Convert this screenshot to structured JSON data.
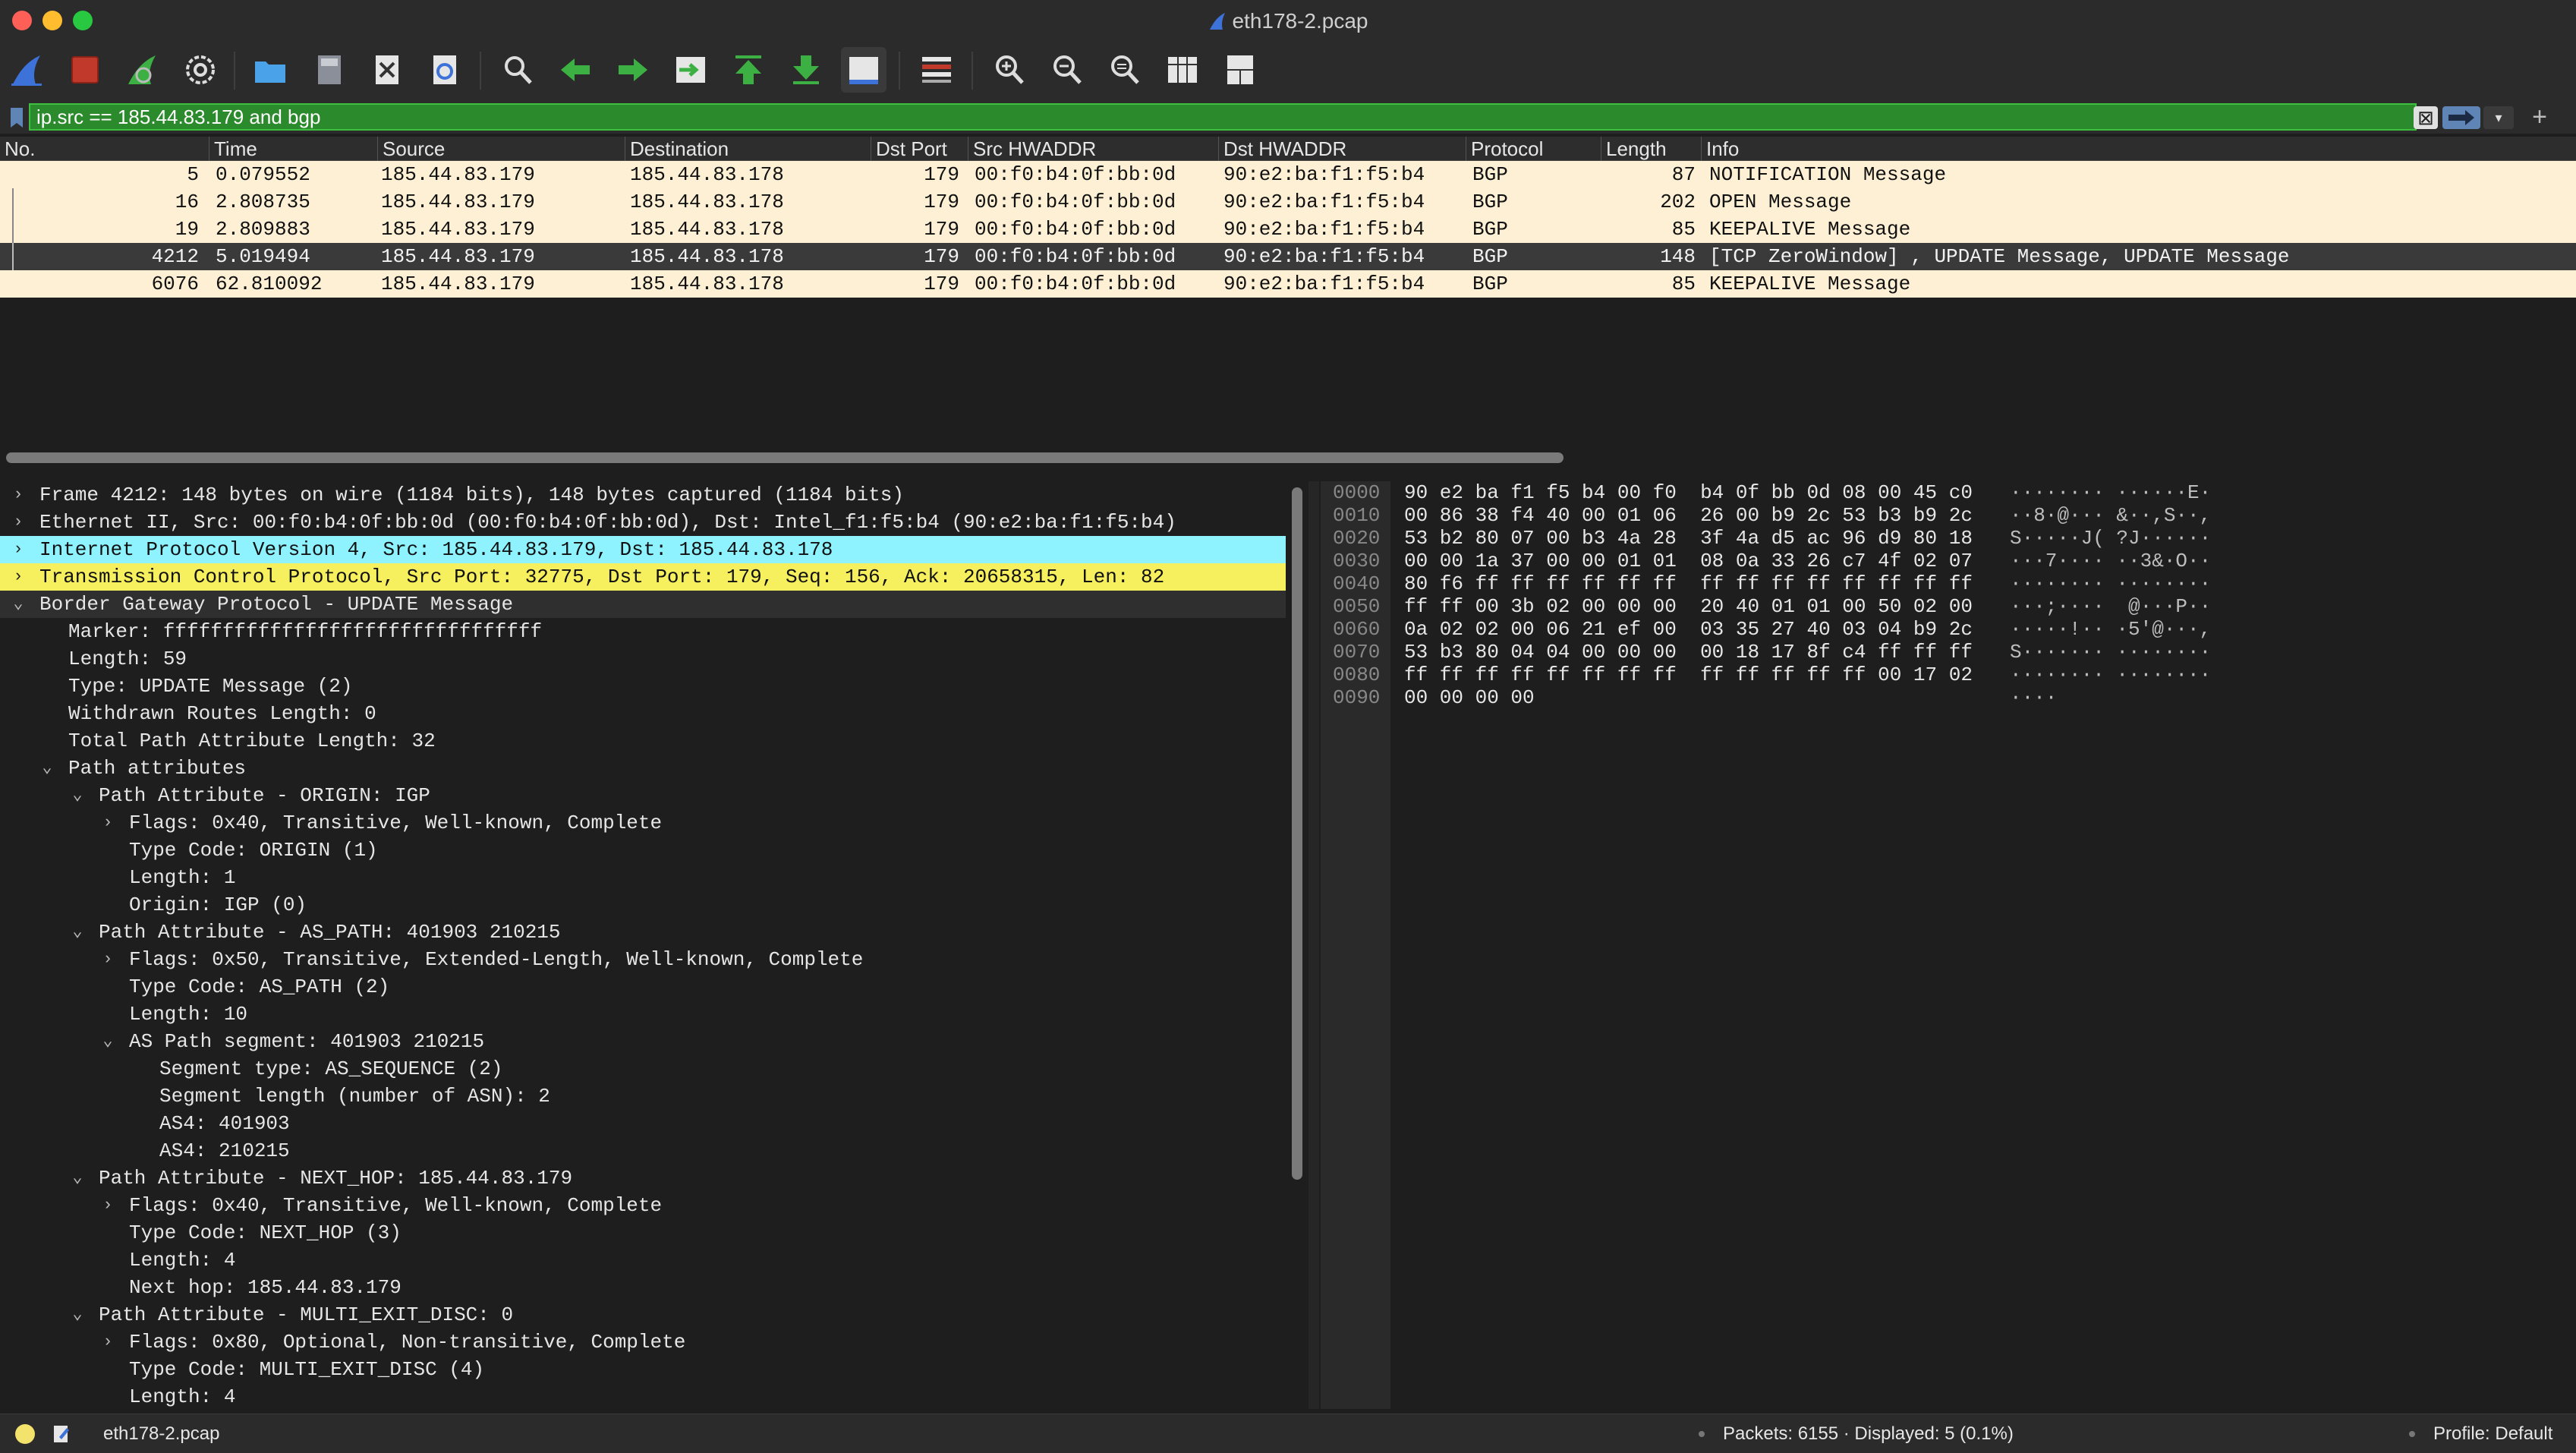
{
  "window": {
    "title": "eth178-2.pcap"
  },
  "toolbar": {
    "icons": [
      "shark-start-icon",
      "stop-icon",
      "restart-icon",
      "options-gear-icon",
      "open-folder-icon",
      "save-file-icon",
      "close-file-icon",
      "reload-icon",
      "find-icon",
      "back-arrow-icon",
      "forward-arrow-icon",
      "goto-packet-icon",
      "first-packet-icon",
      "last-packet-icon",
      "autoscroll-icon",
      "colorize-icon",
      "zoom-in-icon",
      "zoom-out-icon",
      "zoom-normal-icon",
      "resize-columns-icon",
      "layout-icon"
    ],
    "colors": {
      "blue": "#3d72d8",
      "green": "#3cb043",
      "red": "#c0392b"
    }
  },
  "filter": {
    "value": "ip.src == 185.44.83.179 and bgp",
    "clear_label": "⊠",
    "dropdown_label": "▾",
    "add_label": "+"
  },
  "packet_list": {
    "columns": [
      "No.",
      "Time",
      "Source",
      "Destination",
      "Dst Port",
      "Src HWADDR",
      "Dst HWADDR",
      "Protocol",
      "Length",
      "Info"
    ],
    "rows": [
      {
        "no": "5",
        "time": "0.079552",
        "src": "185.44.83.179",
        "dst": "185.44.83.178",
        "dport": "179",
        "srchw": "00:f0:b4:0f:bb:0d",
        "dsthw": "90:e2:ba:f1:f5:b4",
        "proto": "BGP",
        "len": "87",
        "info": "NOTIFICATION Message"
      },
      {
        "no": "16",
        "time": "2.808735",
        "src": "185.44.83.179",
        "dst": "185.44.83.178",
        "dport": "179",
        "srchw": "00:f0:b4:0f:bb:0d",
        "dsthw": "90:e2:ba:f1:f5:b4",
        "proto": "BGP",
        "len": "202",
        "info": "OPEN Message"
      },
      {
        "no": "19",
        "time": "2.809883",
        "src": "185.44.83.179",
        "dst": "185.44.83.178",
        "dport": "179",
        "srchw": "00:f0:b4:0f:bb:0d",
        "dsthw": "90:e2:ba:f1:f5:b4",
        "proto": "BGP",
        "len": "85",
        "info": "KEEPALIVE Message"
      },
      {
        "no": "4212",
        "time": "5.019494",
        "src": "185.44.83.179",
        "dst": "185.44.83.178",
        "dport": "179",
        "srchw": "00:f0:b4:0f:bb:0d",
        "dsthw": "90:e2:ba:f1:f5:b4",
        "proto": "BGP",
        "len": "148",
        "info": "[TCP ZeroWindow] , UPDATE Message, UPDATE Message"
      },
      {
        "no": "6076",
        "time": "62.810092",
        "src": "185.44.83.179",
        "dst": "185.44.83.178",
        "dport": "179",
        "srchw": "00:f0:b4:0f:bb:0d",
        "dsthw": "90:e2:ba:f1:f5:b4",
        "proto": "BGP",
        "len": "85",
        "info": "KEEPALIVE Message"
      }
    ]
  },
  "details": {
    "rows": [
      {
        "text": "Frame 4212: 148 bytes on wire (1184 bits), 148 bytes captured (1184 bits)",
        "arrow": "›"
      },
      {
        "text": "Ethernet II, Src: 00:f0:b4:0f:bb:0d (00:f0:b4:0f:bb:0d), Dst: Intel_f1:f5:b4 (90:e2:ba:f1:f5:b4)",
        "arrow": "›"
      },
      {
        "text": "Internet Protocol Version 4, Src: 185.44.83.179, Dst: 185.44.83.178",
        "arrow": "›"
      },
      {
        "text": "Transmission Control Protocol, Src Port: 32775, Dst Port: 179, Seq: 156, Ack: 20658315, Len: 82",
        "arrow": "›"
      },
      {
        "text": "Border Gateway Protocol - UPDATE Message",
        "arrow": "⌄"
      },
      {
        "text": "Marker: ffffffffffffffffffffffffffffffff",
        "arrow": ""
      },
      {
        "text": "Length: 59",
        "arrow": ""
      },
      {
        "text": "Type: UPDATE Message (2)",
        "arrow": ""
      },
      {
        "text": "Withdrawn Routes Length: 0",
        "arrow": ""
      },
      {
        "text": "Total Path Attribute Length: 32",
        "arrow": ""
      },
      {
        "text": "Path attributes",
        "arrow": "⌄"
      },
      {
        "text": "Path Attribute - ORIGIN: IGP",
        "arrow": "⌄"
      },
      {
        "text": "Flags: 0x40, Transitive, Well-known, Complete",
        "arrow": "›"
      },
      {
        "text": "Type Code: ORIGIN (1)",
        "arrow": ""
      },
      {
        "text": "Length: 1",
        "arrow": ""
      },
      {
        "text": "Origin: IGP (0)",
        "arrow": ""
      },
      {
        "text": "Path Attribute - AS_PATH: 401903 210215",
        "arrow": "⌄"
      },
      {
        "text": "Flags: 0x50, Transitive, Extended-Length, Well-known, Complete",
        "arrow": "›"
      },
      {
        "text": "Type Code: AS_PATH (2)",
        "arrow": ""
      },
      {
        "text": "Length: 10",
        "arrow": ""
      },
      {
        "text": "AS Path segment: 401903 210215",
        "arrow": "⌄"
      },
      {
        "text": "Segment type: AS_SEQUENCE (2)",
        "arrow": ""
      },
      {
        "text": "Segment length (number of ASN): 2",
        "arrow": ""
      },
      {
        "text": "AS4: 401903",
        "arrow": ""
      },
      {
        "text": "AS4: 210215",
        "arrow": ""
      },
      {
        "text": "Path Attribute - NEXT_HOP: 185.44.83.179",
        "arrow": "⌄"
      },
      {
        "text": "Flags: 0x40, Transitive, Well-known, Complete",
        "arrow": "›"
      },
      {
        "text": "Type Code: NEXT_HOP (3)",
        "arrow": ""
      },
      {
        "text": "Length: 4",
        "arrow": ""
      },
      {
        "text": "Next hop: 185.44.83.179",
        "arrow": ""
      },
      {
        "text": "Path Attribute - MULTI_EXIT_DISC: 0",
        "arrow": "⌄"
      },
      {
        "text": "Flags: 0x80, Optional, Non-transitive, Complete",
        "arrow": "›"
      },
      {
        "text": "Type Code: MULTI_EXIT_DISC (4)",
        "arrow": ""
      },
      {
        "text": "Length: 4",
        "arrow": ""
      }
    ]
  },
  "bytes": {
    "rows": [
      {
        "offset": "0000",
        "hex": "90 e2 ba f1 f5 b4 00 f0  b4 0f bb 0d 08 00 45 c0",
        "ascii": "········ ······E·"
      },
      {
        "offset": "0010",
        "hex": "00 86 38 f4 40 00 01 06  26 00 b9 2c 53 b3 b9 2c",
        "ascii": "··8·@··· &··,S··,"
      },
      {
        "offset": "0020",
        "hex": "53 b2 80 07 00 b3 4a 28  3f 4a d5 ac 96 d9 80 18",
        "ascii": "S·····J( ?J······"
      },
      {
        "offset": "0030",
        "hex": "00 00 1a 37 00 00 01 01  08 0a 33 26 c7 4f 02 07",
        "ascii": "···7···· ··3&·O··"
      },
      {
        "offset": "0040",
        "hex": "80 f6 ff ff ff ff ff ff  ff ff ff ff ff ff ff ff",
        "ascii": "········ ········"
      },
      {
        "offset": "0050",
        "hex": "ff ff 00 3b 02 00 00 00  20 40 01 01 00 50 02 00",
        "ascii": "···;····  @···P··"
      },
      {
        "offset": "0060",
        "hex": "0a 02 02 00 06 21 ef 00  03 35 27 40 03 04 b9 2c",
        "ascii": "·····!·· ·5'@···,"
      },
      {
        "offset": "0070",
        "hex": "53 b3 80 04 04 00 00 00  00 18 17 8f c4 ff ff ff",
        "ascii": "S······· ········"
      },
      {
        "offset": "0080",
        "hex": "ff ff ff ff ff ff ff ff  ff ff ff ff ff 00 17 02",
        "ascii": "········ ········"
      },
      {
        "offset": "0090",
        "hex": "00 00 00 00",
        "ascii": "····"
      }
    ]
  },
  "status": {
    "file": "eth178-2.pcap",
    "packets": "Packets: 6155 · Displayed: 5 (0.1%)",
    "profile": "Profile: Default"
  }
}
